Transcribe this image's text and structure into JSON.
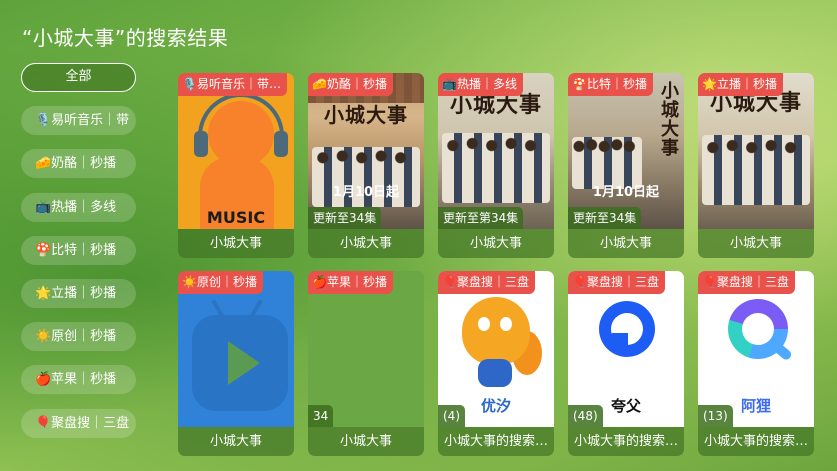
{
  "page": {
    "title": "“小城大事”的搜索结果"
  },
  "sidebar": {
    "items": [
      {
        "label": "全部",
        "active": true
      },
      {
        "label": "🎙️易听音乐｜带"
      },
      {
        "label": "🧀奶酪｜秒播"
      },
      {
        "label": "📺热播｜多线"
      },
      {
        "label": "🍄比特｜秒播"
      },
      {
        "label": "🌟立播｜秒播"
      },
      {
        "label": "☀️原创｜秒播"
      },
      {
        "label": "🍎苹果｜秒播"
      },
      {
        "label": "🎈聚盘搜｜三盘"
      }
    ]
  },
  "results": [
    {
      "source": "🎙️易听音乐｜带…",
      "title": "小城大事",
      "remark": "",
      "poster": "music-icon",
      "poster_text": "MUSIC"
    },
    {
      "source": "🧀奶酪｜秒播",
      "title": "小城大事",
      "remark": "更新至34集",
      "poster": "drama-poster",
      "poster_title": "小城大事",
      "poster_date": "1月10日起"
    },
    {
      "source": "📺热播｜多线",
      "title": "小城大事",
      "remark": "更新至第34集",
      "poster": "drama-poster",
      "poster_title": "小城大事",
      "poster_date": ""
    },
    {
      "source": "🍄比特｜秒播",
      "title": "小城大事",
      "remark": "更新至34集",
      "poster": "drama-poster",
      "poster_title": "小城大事",
      "poster_date": "1月10日起"
    },
    {
      "source": "🌟立播｜秒播",
      "title": "小城大事",
      "remark": "",
      "poster": "drama-poster",
      "poster_title": "小城大事",
      "poster_date": ""
    },
    {
      "source": "☀️原创｜秒播",
      "title": "小城大事",
      "remark": "",
      "poster": "tv-play-icon"
    },
    {
      "source": "🍎苹果｜秒播",
      "title": "小城大事",
      "remark": "34",
      "poster": "blank-poster"
    },
    {
      "source": "🎈聚盘搜｜三盘",
      "title": "小城大事的搜索…",
      "remark": "(4)",
      "poster": "uc-logo",
      "poster_text": "优汐"
    },
    {
      "source": "🎈聚盘搜｜三盘",
      "title": "小城大事的搜索…",
      "remark": "(48)",
      "poster": "quark-logo",
      "poster_text": "夸父"
    },
    {
      "source": "🎈聚盘搜｜三盘",
      "title": "小城大事的搜索…",
      "remark": "(13)",
      "poster": "aliyun-logo",
      "poster_text": "阿狸"
    }
  ],
  "colors": {
    "badge": "#e8524a",
    "accent": "#6ba845"
  }
}
